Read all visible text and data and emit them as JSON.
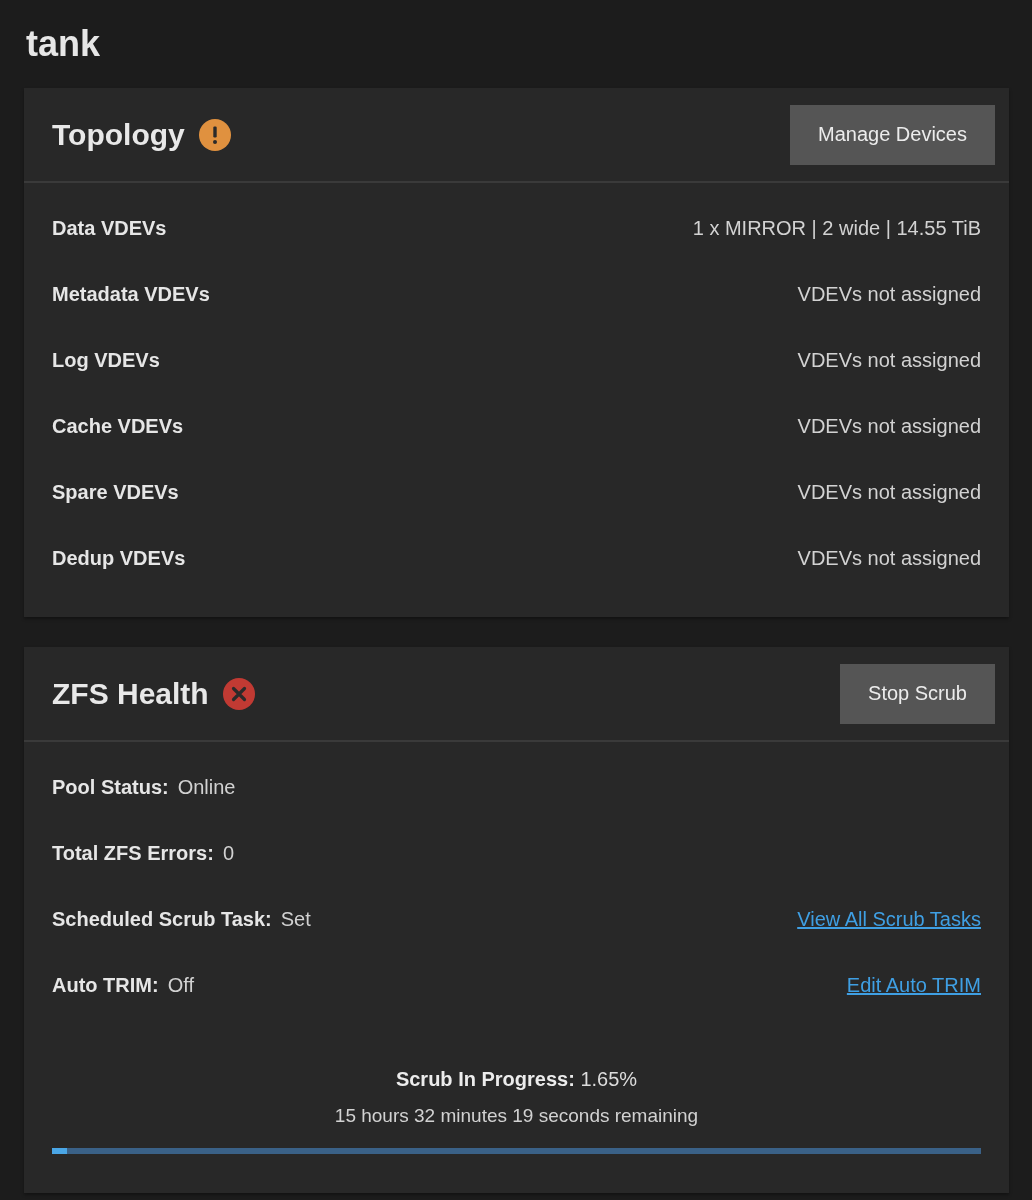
{
  "page_title": "tank",
  "cards": [
    {
      "kind": "topology",
      "title": "Topology",
      "status_icon": {
        "kind": "warning"
      },
      "button": "Manage Devices",
      "rows": [
        {
          "label": "Data VDEVs",
          "value": "1 x MIRROR | 2 wide | 14.55 TiB"
        },
        {
          "label": "Metadata VDEVs",
          "value": "VDEVs not assigned"
        },
        {
          "label": "Log VDEVs",
          "value": "VDEVs not assigned"
        },
        {
          "label": "Cache VDEVs",
          "value": "VDEVs not assigned"
        },
        {
          "label": "Spare VDEVs",
          "value": "VDEVs not assigned"
        },
        {
          "label": "Dedup VDEVs",
          "value": "VDEVs not assigned"
        }
      ]
    },
    {
      "kind": "health",
      "title": "ZFS Health",
      "status_icon": {
        "kind": "error"
      },
      "button": "Stop Scrub",
      "rows": [
        {
          "label": "Pool Status:",
          "value": "Online"
        },
        {
          "label": "Total ZFS Errors:",
          "value": "0"
        },
        {
          "label": "Scheduled Scrub Task:",
          "value": "Set",
          "link": "View All Scrub Tasks"
        },
        {
          "label": "Auto TRIM:",
          "value": "Off",
          "link": "Edit Auto TRIM"
        }
      ],
      "scrub": {
        "heading": "**Scrub In Progress:** 1.65%",
        "remaining": "15 hours 32 minutes 19 seconds remaining",
        "level": 0.0165
      }
    }
  ]
}
